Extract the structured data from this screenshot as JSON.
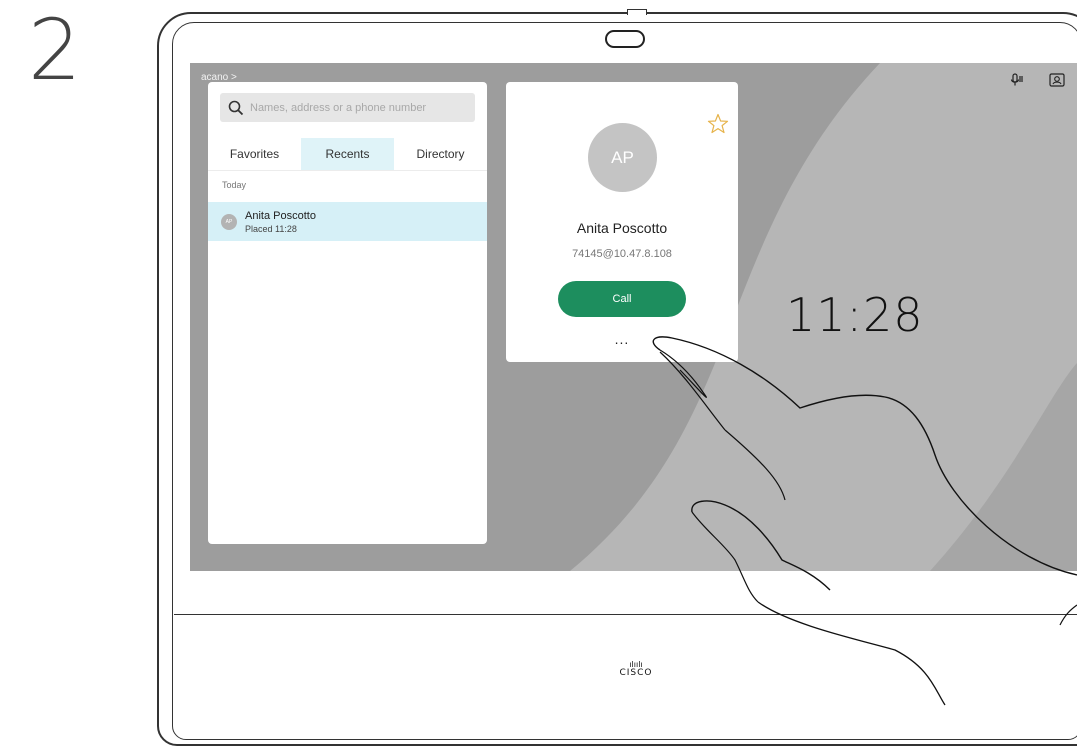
{
  "step": {
    "number": "2"
  },
  "header": {
    "breadcrumb": "acano >"
  },
  "status_icons": [
    "microphone-icon",
    "selfview-icon"
  ],
  "search": {
    "placeholder": "Names, address or a phone number",
    "value": ""
  },
  "tabs": [
    {
      "label": "Favorites",
      "active": false
    },
    {
      "label": "Recents",
      "active": true
    },
    {
      "label": "Directory",
      "active": false
    }
  ],
  "recents": {
    "section_label": "Today",
    "items": [
      {
        "initials": "AP",
        "name": "Anita Poscotto",
        "subtitle": "Placed 11:28"
      }
    ]
  },
  "contact_card": {
    "initials": "AP",
    "name": "Anita Poscotto",
    "address": "74145@10.47.8.108",
    "call_label": "Call",
    "more_label": "...",
    "favorite_icon": "star-outline-icon"
  },
  "clock": {
    "time": "11:28"
  },
  "brand": {
    "name": "CISCO",
    "bars": "ılıılı"
  },
  "colors": {
    "call_green": "#1d8e5e",
    "active_tab": "#dff3f8",
    "selected_row": "#d6f0f7",
    "star": "#e6b34b",
    "screen_bg": "#9d9d9d"
  }
}
